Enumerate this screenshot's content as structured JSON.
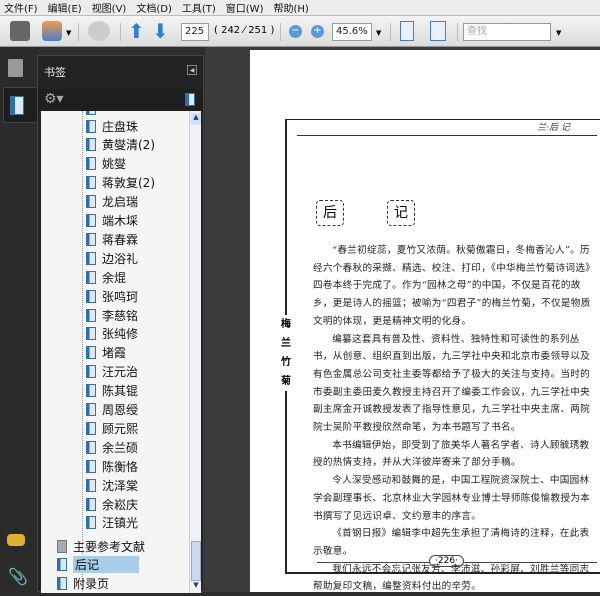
{
  "menu": [
    "文件(F)",
    "编辑(E)",
    "视图(V)",
    "文档(D)",
    "工具(T)",
    "窗口(W)",
    "帮助(H)"
  ],
  "toolbar": {
    "page_input": "225",
    "page_count": "( 242 ⁄ 251 )",
    "zoom": "45.6%",
    "search_placeholder": "查找"
  },
  "panel": {
    "title": "书签"
  },
  "bookmarks": {
    "children": [
      "庄盘珠",
      "黄燮清(2)",
      "姚燮",
      "蒋敦复(2)",
      "龙启瑞",
      "端木埰",
      "蒋春霖",
      "边浴礼",
      "余焜",
      "张鸣珂",
      "李慈铭",
      "张纯修",
      "堵霞",
      "汪元治",
      "陈其锟",
      "周恩绶",
      "顾元熙",
      "余兰硕",
      "陈衡恪",
      "沈泽棠",
      "余崧庆",
      "汪镇光"
    ],
    "top": [
      "主要参考文献",
      "后记",
      "附录页"
    ],
    "selected": "后记"
  },
  "document": {
    "header": "兰·后 记",
    "title_chars": [
      "后",
      "记"
    ],
    "side_label": [
      "梅",
      "兰",
      "竹",
      "菊"
    ],
    "paragraphs": [
      "“春兰初绽蕊，夏竹又浓荫。秋菊傲霜日，冬梅香沁人”。历经六个春秋的采撷、精选、校注、打印，《中华梅兰竹菊诗词选》四卷本终于完成了。作为“园林之母”的中国，不仅是百花的故乡，更是诗人的摇篮；被喻为“四君子”的梅兰竹菊，不仅是物质文明的体现，更是精神文明的化身。",
      "编纂这套具有普及性、资料性、独特性和可读性的系列丛书，从创意、组织直到出版，九三学社中央和北京市委领导以及有色金属总公司支社主委等都给予了极大的关注与支持。当时的市委副主委田麦久教授主持召开了编委工作会议，九三学社中央副主席金开诚教授发表了指导性意见，九三学社中央主席、两院院士吴阶平教授欣然命笔，为本书题写了书名。",
      "本书编辑伊始，即受到了旅美华人著名学者、诗人顾毓琇教授的热情支持，并从大洋彼岸寄来了部分手稿。",
      "令人深受感动和鼓舞的是，中国工程院资深院士、中国园林学会副理事长、北京林业大学园林专业博士导师陈俊愉教授为本书撰写了见远识卓、文约意丰的序言。",
      "《首钢日报》编辑李中超先生承担了清梅诗的注释，在此表示敬意。",
      "我们永远不会忘记张友芳、李沛滋、孙彩屏、刘胜兰等同志帮助复印文稿，编整资料付出的辛劳。"
    ],
    "page_number": "·226·"
  }
}
